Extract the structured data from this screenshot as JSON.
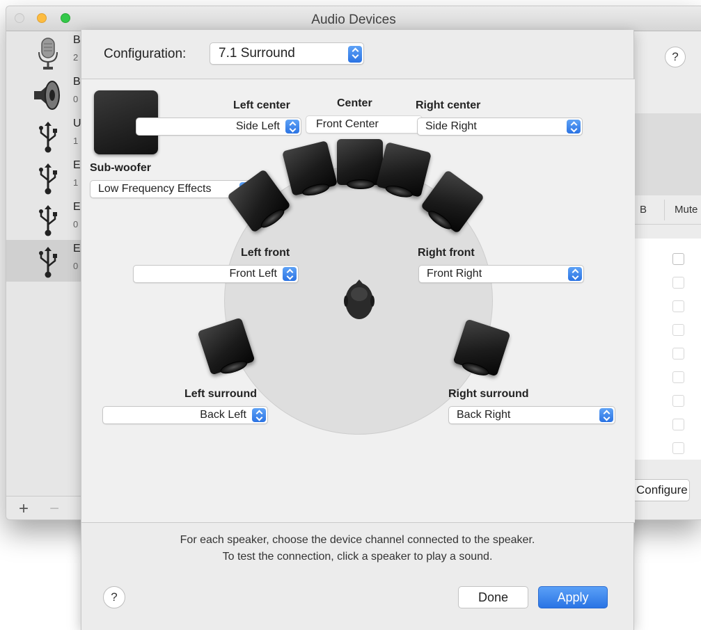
{
  "window": {
    "title": "Audio Devices"
  },
  "sidebar": {
    "devices": [
      {
        "name": "B",
        "sub": "2",
        "icon": "microphone-icon"
      },
      {
        "name": "B",
        "sub": "0",
        "icon": "speaker-icon"
      },
      {
        "name": "U",
        "sub": "1",
        "icon": "usb-icon"
      },
      {
        "name": "El",
        "sub": "1",
        "icon": "usb-icon"
      },
      {
        "name": "El",
        "sub": "0",
        "icon": "usb-icon"
      },
      {
        "name": "El",
        "sub": "0",
        "icon": "usb-icon",
        "selected": true
      }
    ],
    "add_label": "+",
    "remove_label": "−"
  },
  "right_panel": {
    "help_label": "?",
    "col_b": "B",
    "col_mute": "Mute",
    "configure_speakers_label": "Configure Speakers..."
  },
  "sheet": {
    "configuration_label": "Configuration:",
    "configuration_value": "7.1 Surround",
    "speakers": {
      "left_center": {
        "label": "Left center",
        "value": "Side Left"
      },
      "center": {
        "label": "Center",
        "value": "Front Center"
      },
      "right_center": {
        "label": "Right center",
        "value": "Side Right"
      },
      "subwoofer": {
        "label": "Sub-woofer",
        "value": "Low Frequency Effects"
      },
      "left_front": {
        "label": "Left front",
        "value": "Front Left"
      },
      "right_front": {
        "label": "Right front",
        "value": "Front Right"
      },
      "left_surround": {
        "label": "Left surround",
        "value": "Back Left"
      },
      "right_surround": {
        "label": "Right surround",
        "value": "Back Right"
      }
    },
    "instructions_line1": "For each speaker, choose the device channel connected to the speaker.",
    "instructions_line2": "To test the connection, click a speaker to play a sound.",
    "help_label": "?",
    "done_label": "Done",
    "apply_label": "Apply",
    "accent_color": "#2a74e4"
  }
}
